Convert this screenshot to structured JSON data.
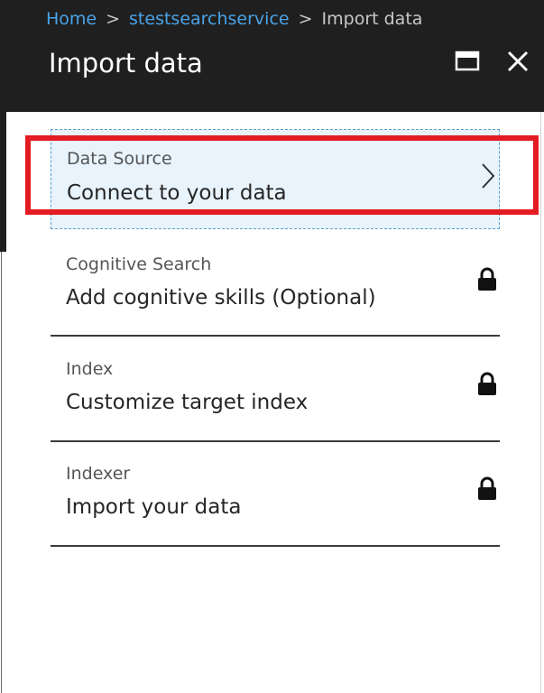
{
  "breadcrumb": {
    "home": "Home",
    "service": "stestsearchservice",
    "current": "Import data",
    "separator": ">"
  },
  "blade": {
    "title": "Import data",
    "maximize_icon": "maximize-icon",
    "close_icon": "close-icon"
  },
  "steps": [
    {
      "label": "Data Source",
      "description": "Connect to your data",
      "state": "active",
      "icon": "chevron-right-icon"
    },
    {
      "label": "Cognitive Search",
      "description": "Add cognitive skills (Optional)",
      "state": "locked",
      "icon": "lock-icon"
    },
    {
      "label": "Index",
      "description": "Customize target index",
      "state": "locked",
      "icon": "lock-icon"
    },
    {
      "label": "Indexer",
      "description": "Import your data",
      "state": "locked",
      "icon": "lock-icon"
    }
  ],
  "colors": {
    "header_bg": "#1f1f1f",
    "link": "#4aa3e8",
    "active_step_bg": "#e8f3fc",
    "highlight": "#e31b23"
  }
}
